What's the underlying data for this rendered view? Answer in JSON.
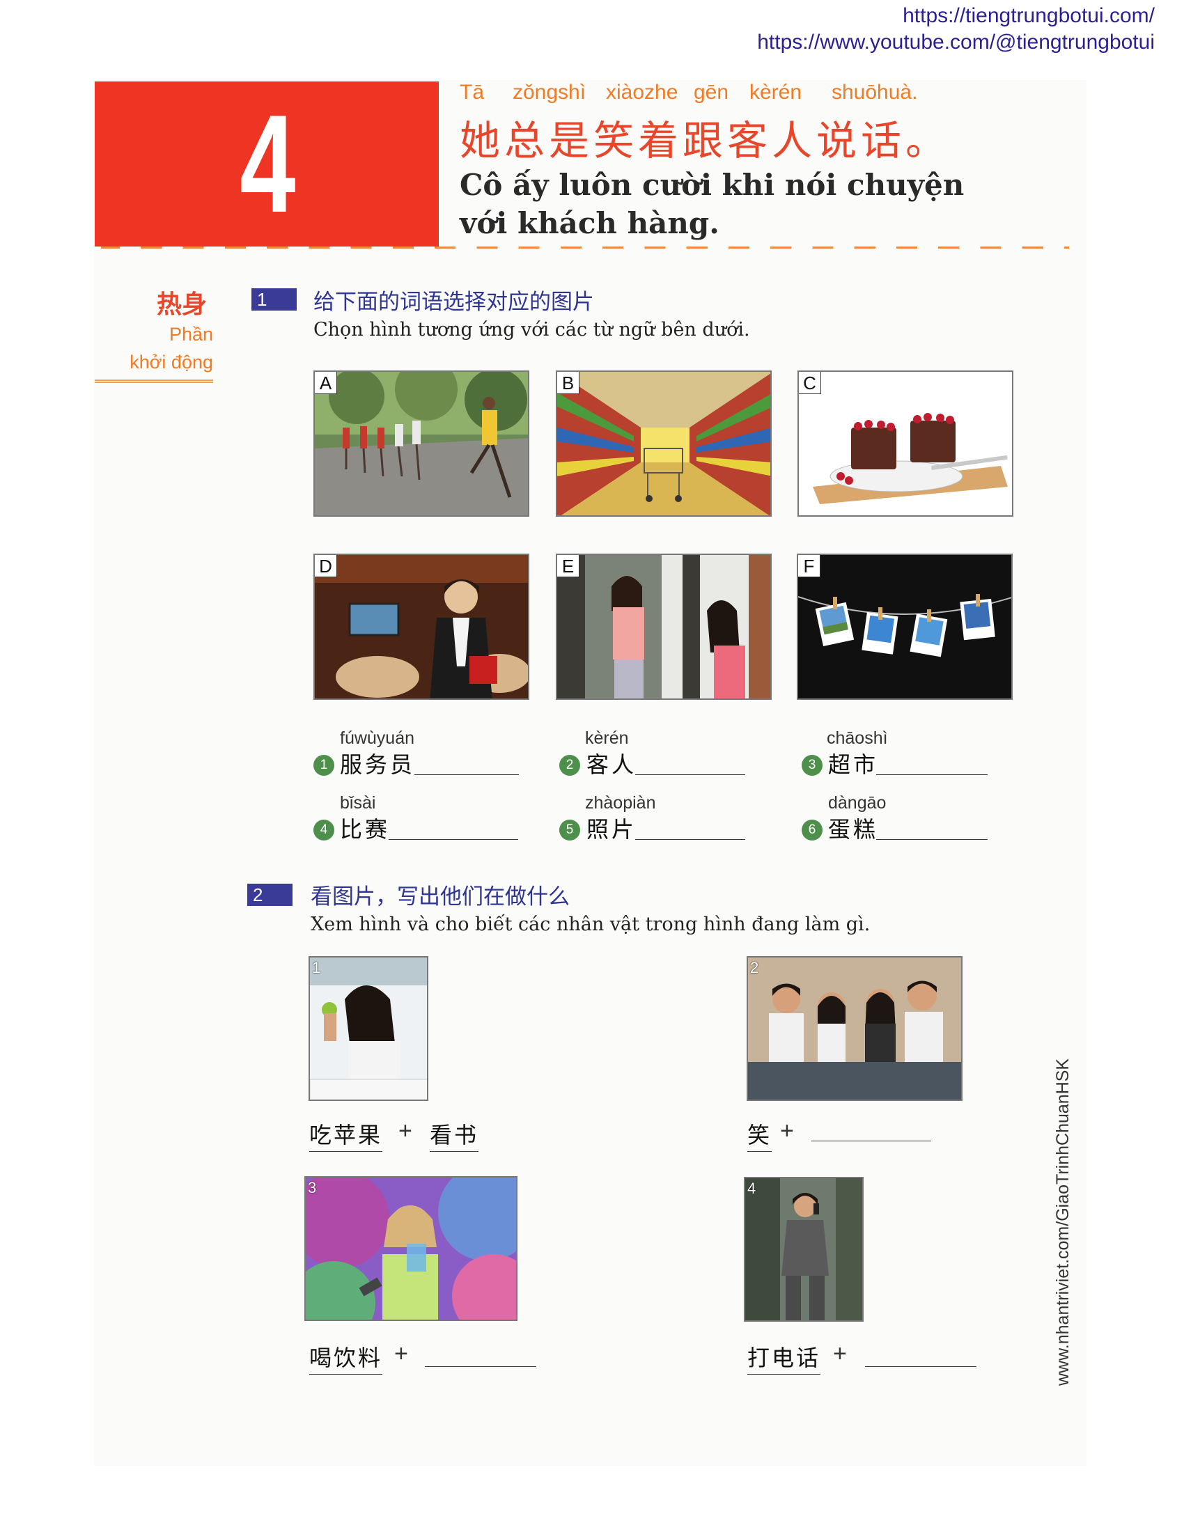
{
  "watermark": {
    "url1": "https://tiengtrungbotui.com/",
    "url2": "https://www.youtube.com/@tiengtrungbotui"
  },
  "lesson": {
    "number": "4",
    "pinyin": [
      "Tā",
      "zǒngshì",
      "xiàozhe",
      "gēn",
      "kèrén",
      "shuōhuà."
    ],
    "hanzi": "她总是笑着跟客人说话。",
    "vietnamese": "Cô ấy luôn cười khi nói chuyện với khách hàng."
  },
  "warmup": {
    "chinese": "热身",
    "vietnamese_line1": "Phần",
    "vietnamese_line2": "khởi động"
  },
  "exercise1": {
    "number": "1",
    "instruction_cn": "给下面的词语选择对应的图片",
    "instruction_vn": "Chọn hình tương ứng với các từ ngữ bên dưới.",
    "pictures": [
      {
        "letter": "A",
        "subject": "marathon runners"
      },
      {
        "letter": "B",
        "subject": "supermarket aisle with cart"
      },
      {
        "letter": "C",
        "subject": "chocolate cakes"
      },
      {
        "letter": "D",
        "subject": "waiter in restaurant"
      },
      {
        "letter": "E",
        "subject": "guest at door"
      },
      {
        "letter": "F",
        "subject": "photos on a line"
      }
    ],
    "vocab": [
      {
        "num": "1",
        "pinyin": "fúwùyuán",
        "hanzi": "服务员"
      },
      {
        "num": "2",
        "pinyin": "kèrén",
        "hanzi": "客人"
      },
      {
        "num": "3",
        "pinyin": "chāoshì",
        "hanzi": "超市"
      },
      {
        "num": "4",
        "pinyin": "bǐsài",
        "hanzi": "比赛"
      },
      {
        "num": "5",
        "pinyin": "zhàopiàn",
        "hanzi": "照片"
      },
      {
        "num": "6",
        "pinyin": "dàngāo",
        "hanzi": "蛋糕"
      }
    ]
  },
  "exercise2": {
    "number": "2",
    "instruction_cn": "看图片，写出他们在做什么",
    "instruction_vn": "Xem hình và cho biết các nhân vật trong hình đang làm gì.",
    "items": [
      {
        "num": "1",
        "word1": "吃苹果",
        "plus": "+",
        "word2": "看书"
      },
      {
        "num": "2",
        "word1": "笑",
        "plus": "+",
        "word2": ""
      },
      {
        "num": "3",
        "word1": "喝饮料",
        "plus": "+",
        "word2": ""
      },
      {
        "num": "4",
        "word1": "打电话",
        "plus": "+",
        "word2": ""
      }
    ]
  },
  "side_text": "www.nhantriviet.com/GiaoTrinhChuanHSK",
  "colors": {
    "lesson_red": "#ee3524",
    "pinyin_orange": "#f07b24",
    "section_blue": "#3a3b96",
    "number_green": "#4d8f4b"
  }
}
